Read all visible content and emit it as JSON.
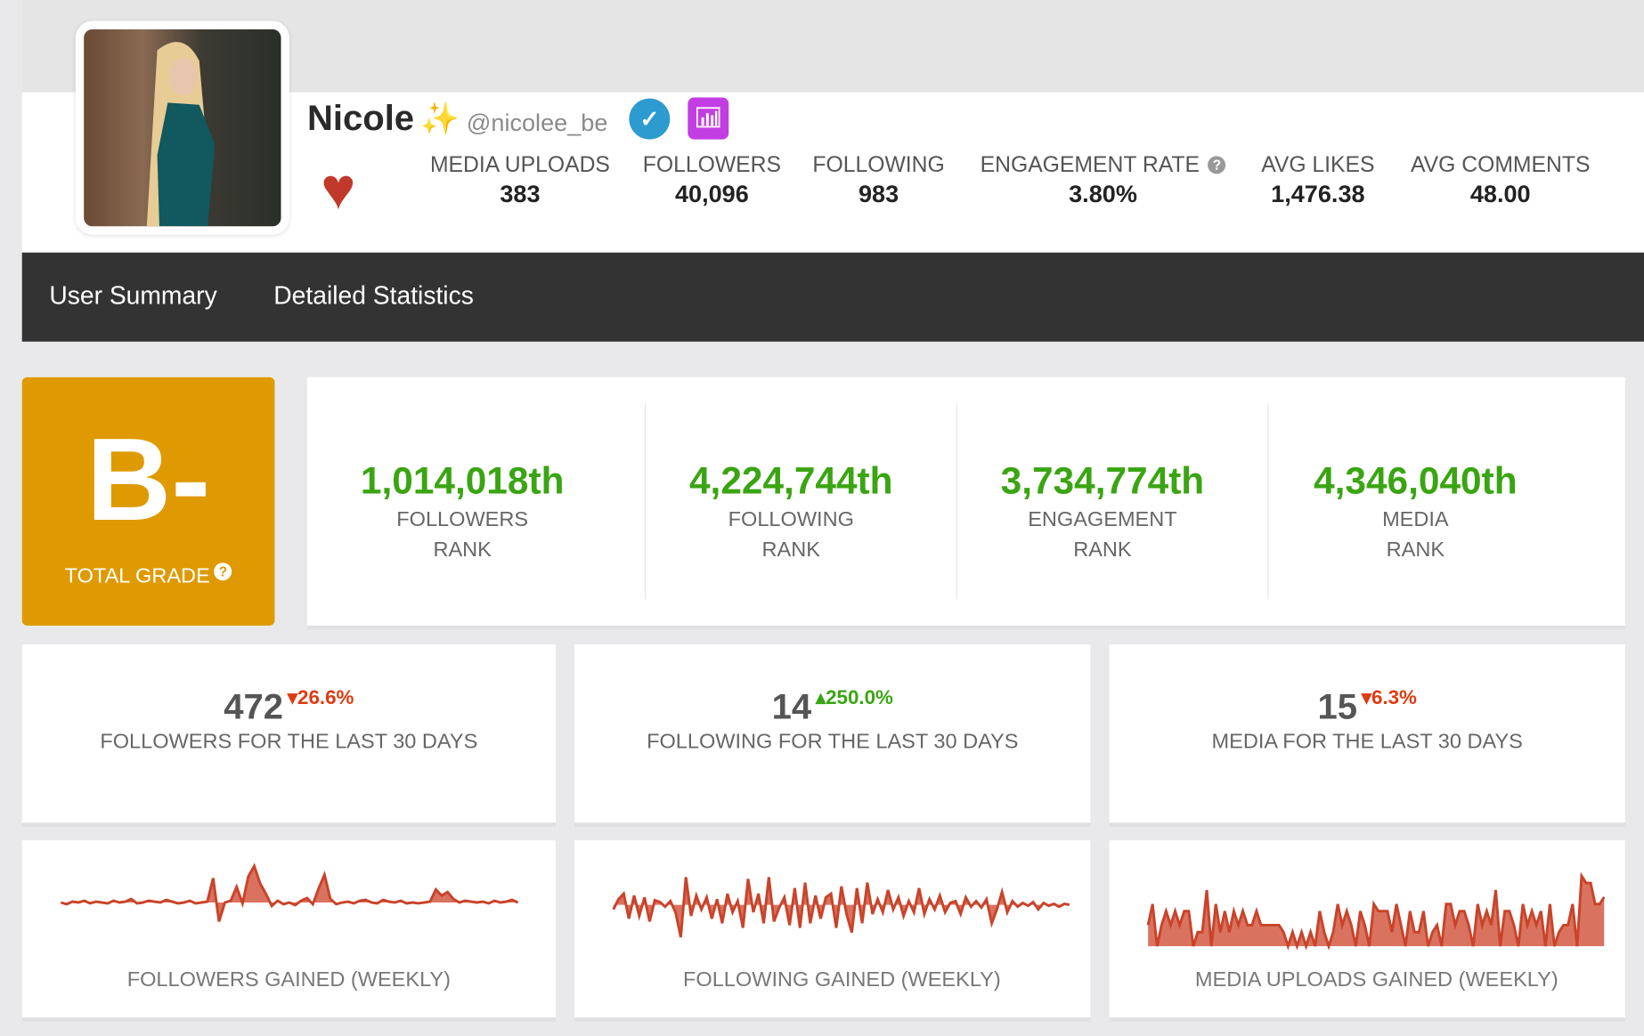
{
  "profile": {
    "name": "Nicole",
    "name_emoji": "✨",
    "handle": "@nicolee_be",
    "verified_icon": "check-circle-icon",
    "stats_icon": "bar-chart-icon",
    "favorite_icon": "heart-icon"
  },
  "stats": [
    {
      "label": "MEDIA UPLOADS",
      "value": "383"
    },
    {
      "label": "FOLLOWERS",
      "value": "40,096"
    },
    {
      "label": "FOLLOWING",
      "value": "983"
    },
    {
      "label": "ENGAGEMENT RATE",
      "value": "3.80%",
      "help": "?"
    },
    {
      "label": "AVG LIKES",
      "value": "1,476.38"
    },
    {
      "label": "AVG COMMENTS",
      "value": "48.00"
    }
  ],
  "nav": {
    "tabs": [
      {
        "label": "User Summary"
      },
      {
        "label": "Detailed Statistics"
      }
    ]
  },
  "grade": {
    "letter": "B-",
    "label": "TOTAL GRADE",
    "help": "?",
    "color": "#de9a00"
  },
  "ranks": [
    {
      "value": "1,014,018th",
      "label1": "FOLLOWERS",
      "label2": "RANK"
    },
    {
      "value": "4,224,744th",
      "label1": "FOLLOWING",
      "label2": "RANK"
    },
    {
      "value": "3,734,774th",
      "label1": "ENGAGEMENT",
      "label2": "RANK"
    },
    {
      "value": "4,346,040th",
      "label1": "MEDIA",
      "label2": "RANK"
    }
  ],
  "last30": [
    {
      "value": "472",
      "change": "26.6%",
      "direction": "down",
      "label": "FOLLOWERS FOR THE LAST 30 DAYS"
    },
    {
      "value": "14",
      "change": "250.0%",
      "direction": "up",
      "label": "FOLLOWING FOR THE LAST 30 DAYS"
    },
    {
      "value": "15",
      "change": "6.3%",
      "direction": "down",
      "label": "MEDIA FOR THE LAST 30 DAYS"
    }
  ],
  "colors": {
    "up": "#3aa512",
    "down": "#e03a10",
    "spark": "#c9432a",
    "spark_fill": "#d9735f"
  },
  "chart_data": [
    {
      "type": "area",
      "label": "FOLLOWERS GAINED (WEEKLY)",
      "values": [
        0,
        -2,
        1,
        0,
        2,
        -1,
        1,
        0,
        -1,
        2,
        0,
        1,
        4,
        -1,
        0,
        2,
        1,
        0,
        3,
        1,
        -1,
        0,
        2,
        -1,
        0,
        1,
        28,
        -22,
        0,
        2,
        18,
        -1,
        30,
        42,
        22,
        10,
        -4,
        2,
        -2,
        0,
        -3,
        2,
        5,
        -2,
        16,
        32,
        4,
        -2,
        0,
        1,
        -1,
        2,
        3,
        0,
        -1,
        3,
        1,
        0,
        2,
        -1,
        0,
        -1,
        0,
        1,
        15,
        8,
        12,
        4,
        0,
        2,
        1,
        0,
        1,
        -1,
        2,
        0,
        1,
        3,
        0
      ]
    },
    {
      "type": "area",
      "label": "FOLLOWING GAINED (WEEKLY)",
      "values": [
        -5,
        6,
        12,
        -15,
        10,
        -12,
        8,
        -18,
        5,
        3,
        -2,
        4,
        -8,
        -35,
        30,
        -12,
        10,
        -5,
        8,
        -15,
        6,
        -20,
        12,
        -8,
        4,
        -25,
        28,
        -8,
        12,
        -20,
        30,
        -18,
        -3,
        8,
        -22,
        18,
        -25,
        24,
        -20,
        10,
        -15,
        8,
        12,
        -25,
        20,
        -10,
        -30,
        18,
        -20,
        24,
        -10,
        6,
        -8,
        16,
        -5,
        8,
        -12,
        4,
        -8,
        18,
        -10,
        6,
        -5,
        10,
        -8,
        2,
        4,
        -10,
        8,
        -2,
        4,
        -3,
        6,
        -20,
        -5,
        14,
        -8,
        4,
        -2,
        2,
        -1,
        3,
        -5,
        2,
        -1,
        1,
        -2,
        1,
        0
      ]
    },
    {
      "type": "area",
      "label": "MEDIA UPLOADS GAINED (WEEKLY)",
      "values": [
        3,
        6,
        0,
        3,
        5,
        3,
        5,
        3,
        5,
        5,
        0,
        2,
        2,
        8,
        0,
        6,
        2,
        5,
        2,
        5,
        3,
        5,
        3,
        3,
        5,
        3,
        3,
        3,
        3,
        3,
        2,
        0,
        2,
        0,
        2,
        0,
        2,
        0,
        5,
        2,
        0,
        2,
        6,
        3,
        5,
        3,
        0,
        5,
        3,
        0,
        6,
        5,
        5,
        5,
        2,
        6,
        3,
        0,
        5,
        2,
        2,
        5,
        0,
        2,
        3,
        0,
        6,
        6,
        3,
        5,
        5,
        3,
        0,
        6,
        3,
        5,
        3,
        8,
        0,
        5,
        5,
        3,
        0,
        6,
        3,
        5,
        3,
        5,
        0,
        6,
        0,
        2,
        3,
        3,
        6,
        0,
        10,
        9,
        9,
        6,
        6,
        7
      ]
    }
  ]
}
